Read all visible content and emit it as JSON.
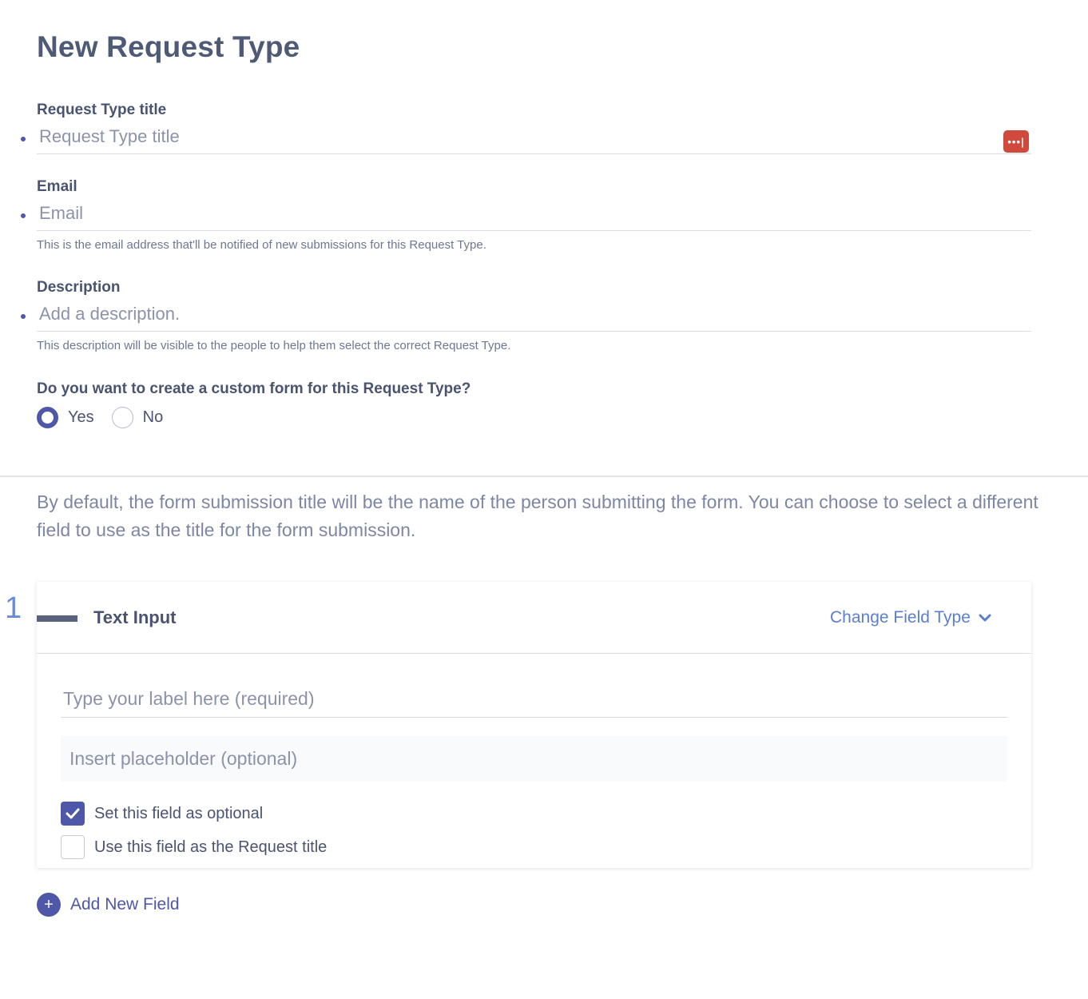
{
  "page": {
    "title": "New Request Type"
  },
  "fields": {
    "title": {
      "label": "Request Type title",
      "placeholder": "Request Type title",
      "badge": "•••|"
    },
    "email": {
      "label": "Email",
      "placeholder": "Email",
      "help": "This is the email address that'll be notified of new submissions for this Request Type."
    },
    "description": {
      "label": "Description",
      "placeholder": "Add a description.",
      "help": "This description will be visible to the people to help them select the correct Request Type."
    }
  },
  "custom_form": {
    "question": "Do you want to create a custom form for this Request Type?",
    "options": [
      {
        "label": "Yes",
        "selected": true
      },
      {
        "label": "No",
        "selected": false
      }
    ]
  },
  "intro": "By default, the form submission title will be the name of the person submitting the form. You can choose to select a different field to use as the title for the form submission.",
  "form_field": {
    "number": "1",
    "type": "Text Input",
    "change_type_label": "Change Field Type",
    "label_placeholder": "Type your label here (required)",
    "placeholder_placeholder": "Insert placeholder (optional)",
    "checkboxes": [
      {
        "label": "Set this field as optional",
        "checked": true
      },
      {
        "label": "Use this field as the Request title",
        "checked": false
      }
    ]
  },
  "add_field": {
    "label": "Add New Field",
    "icon": "+"
  },
  "colors": {
    "accent": "#4e57a8",
    "link": "#5b7fd0",
    "badge": "#cf4a3c"
  }
}
